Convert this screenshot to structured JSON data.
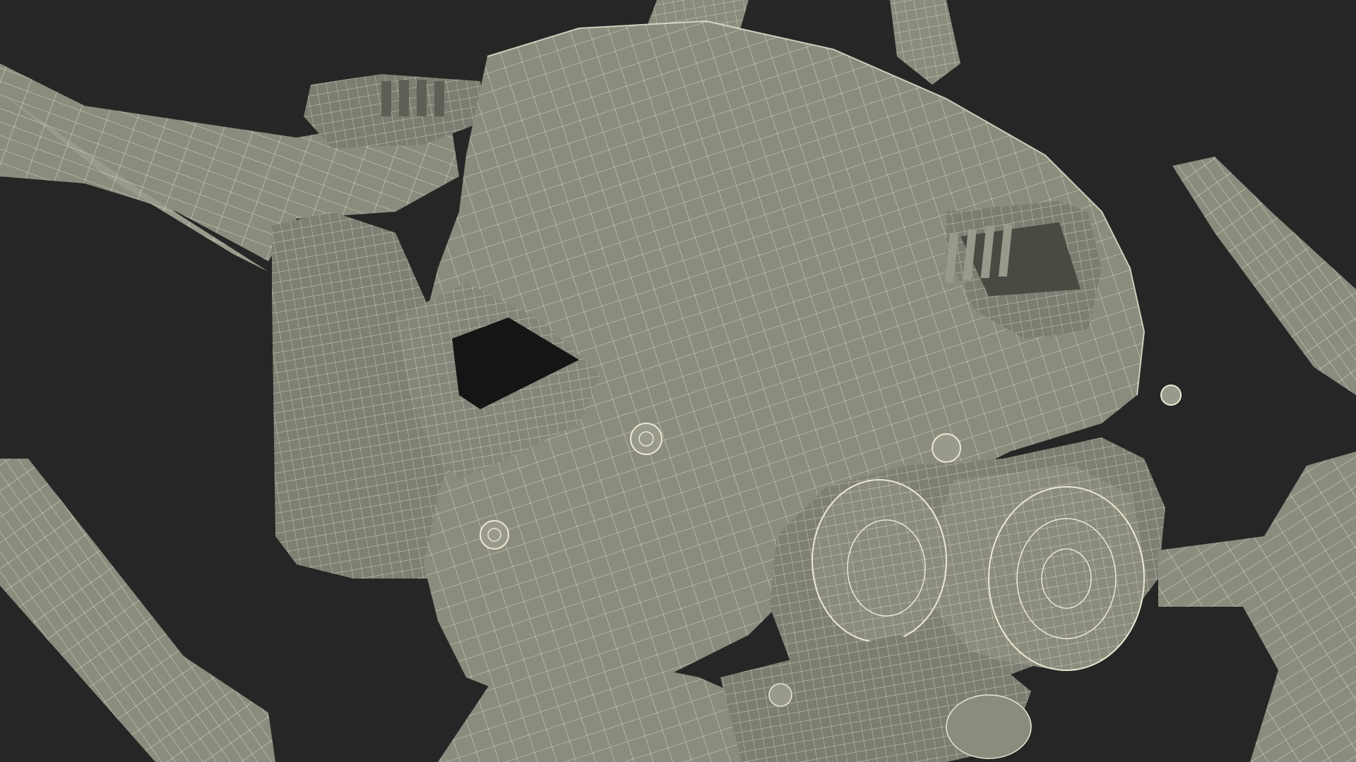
{
  "scene": {
    "subject": "drone-wireframe-render",
    "colors": {
      "background": "#262626",
      "surface": "#8b8b7e",
      "surface_light": "#9a9a8c",
      "surface_dark": "#6f6f64",
      "wire": "#e9e9d4",
      "cavity": "#151515"
    }
  }
}
